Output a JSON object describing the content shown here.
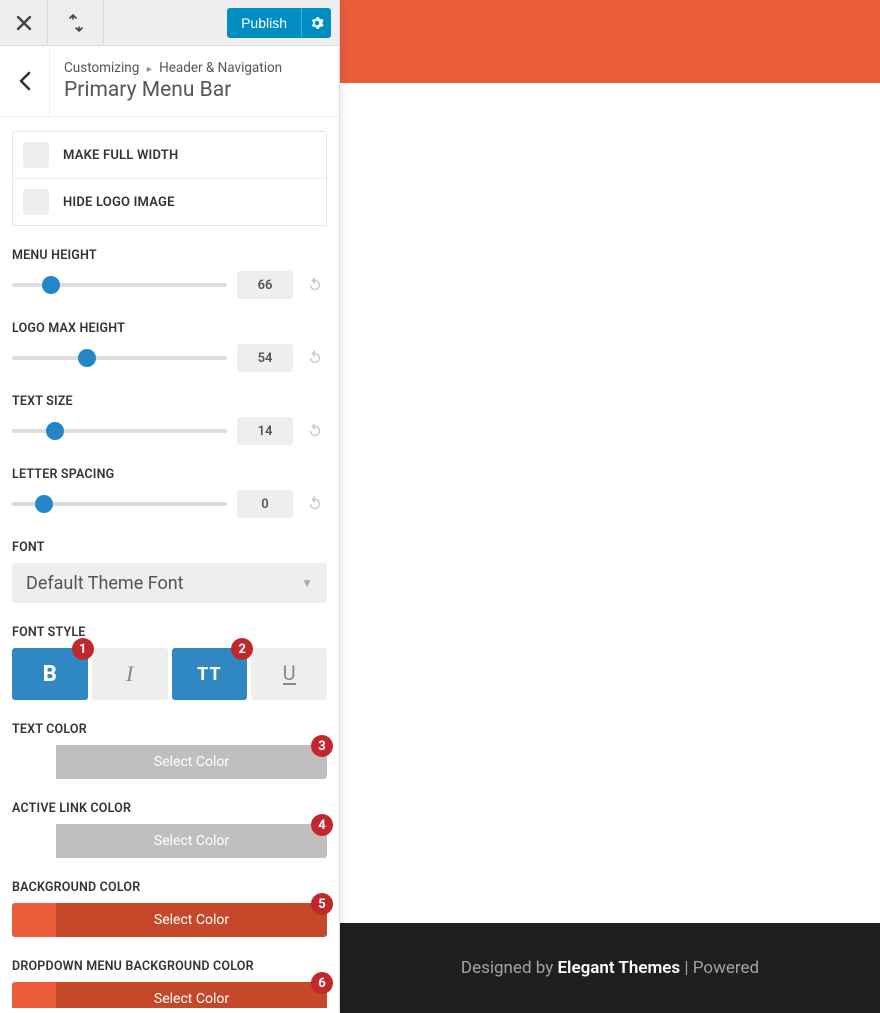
{
  "topbar": {
    "publish_label": "Publish"
  },
  "breadcrumb": {
    "root": "Customizing",
    "section": "Header & Navigation",
    "title": "Primary Menu Bar"
  },
  "checks": {
    "full_width": "MAKE FULL WIDTH",
    "hide_logo": "HIDE LOGO IMAGE"
  },
  "sliders": {
    "menu_height": {
      "label": "MENU HEIGHT",
      "value": "66",
      "pct": 18
    },
    "logo_max_height": {
      "label": "LOGO MAX HEIGHT",
      "value": "54",
      "pct": 35
    },
    "text_size": {
      "label": "TEXT SIZE",
      "value": "14",
      "pct": 20
    },
    "letter_spacing": {
      "label": "LETTER SPACING",
      "value": "0",
      "pct": 15
    }
  },
  "font": {
    "label": "FONT",
    "value": "Default Theme Font"
  },
  "font_style": {
    "label": "FONT STYLE",
    "bold": "B",
    "italic": "I",
    "uppercase": "TT",
    "underline": "U"
  },
  "colors": {
    "text": {
      "label": "TEXT COLOR",
      "button": "Select Color",
      "swatch": "#ffffff",
      "btn_bg": "#bfbfbf"
    },
    "active_link": {
      "label": "ACTIVE LINK COLOR",
      "button": "Select Color",
      "swatch": "#ffffff",
      "btn_bg": "#bfbfbf"
    },
    "background": {
      "label": "BACKGROUND COLOR",
      "button": "Select Color",
      "swatch": "#ea5c3a",
      "btn_bg": "#c6482a"
    },
    "dropdown_bg": {
      "label": "DROPDOWN MENU BACKGROUND COLOR",
      "button": "Select Color",
      "swatch": "#ea5c3a",
      "btn_bg": "#c6482a"
    }
  },
  "annotations": {
    "b1": "1",
    "b2": "2",
    "b3": "3",
    "b4": "4",
    "b5": "5",
    "b6": "6"
  },
  "footer": {
    "prefix": "Designed by ",
    "brand": "Elegant Themes",
    "suffix": " | Powered"
  }
}
